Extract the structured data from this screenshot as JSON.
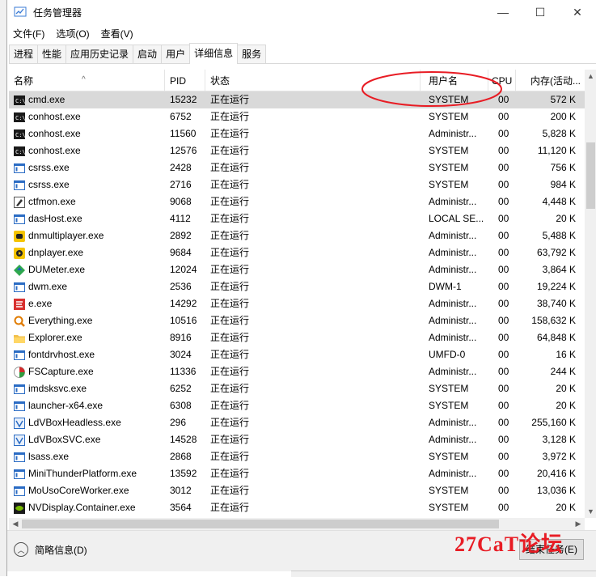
{
  "window": {
    "title": "任务管理器",
    "controls": {
      "minimize": "—",
      "maximize": "☐",
      "close": "✕"
    }
  },
  "menu": [
    "文件(F)",
    "选项(O)",
    "查看(V)"
  ],
  "tabs": [
    {
      "label": "进程",
      "active": false
    },
    {
      "label": "性能",
      "active": false
    },
    {
      "label": "应用历史记录",
      "active": false
    },
    {
      "label": "启动",
      "active": false
    },
    {
      "label": "用户",
      "active": false
    },
    {
      "label": "详细信息",
      "active": true
    },
    {
      "label": "服务",
      "active": false
    }
  ],
  "columns": {
    "name": "名称",
    "pid": "PID",
    "status": "状态",
    "user": "用户名",
    "cpu": "CPU",
    "memory": "内存(活动..."
  },
  "rows": [
    {
      "icon": "cmd-icon",
      "name": "cmd.exe",
      "pid": "15232",
      "status": "正在运行",
      "user": "SYSTEM",
      "cpu": "00",
      "mem": "572 K",
      "selected": true
    },
    {
      "icon": "console-icon",
      "name": "conhost.exe",
      "pid": "6752",
      "status": "正在运行",
      "user": "SYSTEM",
      "cpu": "00",
      "mem": "200 K"
    },
    {
      "icon": "console-icon",
      "name": "conhost.exe",
      "pid": "11560",
      "status": "正在运行",
      "user": "Administr...",
      "cpu": "00",
      "mem": "5,828 K"
    },
    {
      "icon": "console-icon",
      "name": "conhost.exe",
      "pid": "12576",
      "status": "正在运行",
      "user": "SYSTEM",
      "cpu": "00",
      "mem": "11,120 K"
    },
    {
      "icon": "window-icon",
      "name": "csrss.exe",
      "pid": "2428",
      "status": "正在运行",
      "user": "SYSTEM",
      "cpu": "00",
      "mem": "756 K"
    },
    {
      "icon": "window-icon",
      "name": "csrss.exe",
      "pid": "2716",
      "status": "正在运行",
      "user": "SYSTEM",
      "cpu": "00",
      "mem": "984 K"
    },
    {
      "icon": "pen-icon",
      "name": "ctfmon.exe",
      "pid": "9068",
      "status": "正在运行",
      "user": "Administr...",
      "cpu": "00",
      "mem": "4,448 K"
    },
    {
      "icon": "window-icon",
      "name": "dasHost.exe",
      "pid": "4112",
      "status": "正在运行",
      "user": "LOCAL SE...",
      "cpu": "00",
      "mem": "20 K"
    },
    {
      "icon": "gamepad-icon",
      "name": "dnmultiplayer.exe",
      "pid": "2892",
      "status": "正在运行",
      "user": "Administr...",
      "cpu": "00",
      "mem": "5,488 K"
    },
    {
      "icon": "play-icon",
      "name": "dnplayer.exe",
      "pid": "9684",
      "status": "正在运行",
      "user": "Administr...",
      "cpu": "00",
      "mem": "63,792 K"
    },
    {
      "icon": "meter-icon",
      "name": "DUMeter.exe",
      "pid": "12024",
      "status": "正在运行",
      "user": "Administr...",
      "cpu": "00",
      "mem": "3,864 K"
    },
    {
      "icon": "window-icon",
      "name": "dwm.exe",
      "pid": "2536",
      "status": "正在运行",
      "user": "DWM-1",
      "cpu": "00",
      "mem": "19,224 K"
    },
    {
      "icon": "e-icon",
      "name": "e.exe",
      "pid": "14292",
      "status": "正在运行",
      "user": "Administr...",
      "cpu": "00",
      "mem": "38,740 K"
    },
    {
      "icon": "magnifier-icon",
      "name": "Everything.exe",
      "pid": "10516",
      "status": "正在运行",
      "user": "Administr...",
      "cpu": "00",
      "mem": "158,632 K"
    },
    {
      "icon": "folder-icon",
      "name": "Explorer.exe",
      "pid": "8916",
      "status": "正在运行",
      "user": "Administr...",
      "cpu": "00",
      "mem": "64,848 K"
    },
    {
      "icon": "window-icon",
      "name": "fontdrvhost.exe",
      "pid": "3024",
      "status": "正在运行",
      "user": "UMFD-0",
      "cpu": "00",
      "mem": "16 K"
    },
    {
      "icon": "capture-icon",
      "name": "FSCapture.exe",
      "pid": "11336",
      "status": "正在运行",
      "user": "Administr...",
      "cpu": "00",
      "mem": "244 K"
    },
    {
      "icon": "window-icon",
      "name": "imdsksvc.exe",
      "pid": "6252",
      "status": "正在运行",
      "user": "SYSTEM",
      "cpu": "00",
      "mem": "20 K"
    },
    {
      "icon": "window-icon",
      "name": "launcher-x64.exe",
      "pid": "6308",
      "status": "正在运行",
      "user": "SYSTEM",
      "cpu": "00",
      "mem": "20 K"
    },
    {
      "icon": "vbox-icon",
      "name": "LdVBoxHeadless.exe",
      "pid": "296",
      "status": "正在运行",
      "user": "Administr...",
      "cpu": "00",
      "mem": "255,160 K"
    },
    {
      "icon": "vbox-icon",
      "name": "LdVBoxSVC.exe",
      "pid": "14528",
      "status": "正在运行",
      "user": "Administr...",
      "cpu": "00",
      "mem": "3,128 K"
    },
    {
      "icon": "window-icon",
      "name": "lsass.exe",
      "pid": "2868",
      "status": "正在运行",
      "user": "SYSTEM",
      "cpu": "00",
      "mem": "3,972 K"
    },
    {
      "icon": "window-icon",
      "name": "MiniThunderPlatform.exe",
      "pid": "13592",
      "status": "正在运行",
      "user": "Administr...",
      "cpu": "00",
      "mem": "20,416 K"
    },
    {
      "icon": "window-icon",
      "name": "MoUsoCoreWorker.exe",
      "pid": "3012",
      "status": "正在运行",
      "user": "SYSTEM",
      "cpu": "00",
      "mem": "13,036 K"
    },
    {
      "icon": "nvidia-icon",
      "name": "NVDisplay.Container.exe",
      "pid": "3564",
      "status": "正在运行",
      "user": "SYSTEM",
      "cpu": "00",
      "mem": "20 K"
    }
  ],
  "footer": {
    "fewer_details": "简略信息(D)",
    "end_task": "结束任务(E)"
  },
  "watermark": "27CaT论坛",
  "colors": {
    "selected_row": "#d9d9d9",
    "annotation_circle": "#e81c24"
  }
}
